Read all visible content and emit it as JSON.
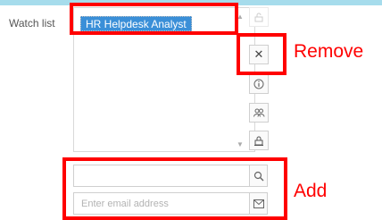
{
  "watch_list": {
    "label": "Watch list",
    "items": [
      "HR Helpdesk Analyst"
    ]
  },
  "buttons": {
    "remove_glyph": "✕"
  },
  "add": {
    "search_value": "",
    "email_placeholder": "Enter email address"
  },
  "annotations": {
    "remove_label": "Remove",
    "add_label": "Add",
    "color": "#ff0000"
  },
  "colors": {
    "selection": "#3a8fd8",
    "top_strip": "#a6dcec"
  }
}
